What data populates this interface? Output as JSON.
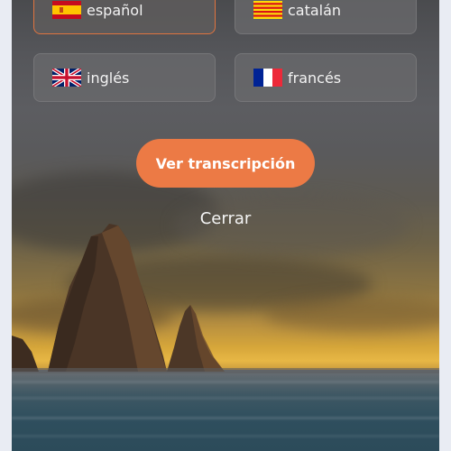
{
  "languages": {
    "spanish": {
      "label": "español",
      "selected": true
    },
    "catalan": {
      "label": "catalán",
      "selected": false
    },
    "english": {
      "label": "inglés",
      "selected": false
    },
    "french": {
      "label": "francés",
      "selected": false
    }
  },
  "actions": {
    "view_transcript_label": "Ver transcripción",
    "close_label": "Cerrar"
  },
  "colors": {
    "accent": "#ec7a45",
    "button_bg": "#69696c",
    "text": "#f3f3f3"
  },
  "icons": {
    "spanish": "spain-flag-icon",
    "catalan": "catalonia-flag-icon",
    "english": "uk-flag-icon",
    "french": "france-flag-icon"
  }
}
